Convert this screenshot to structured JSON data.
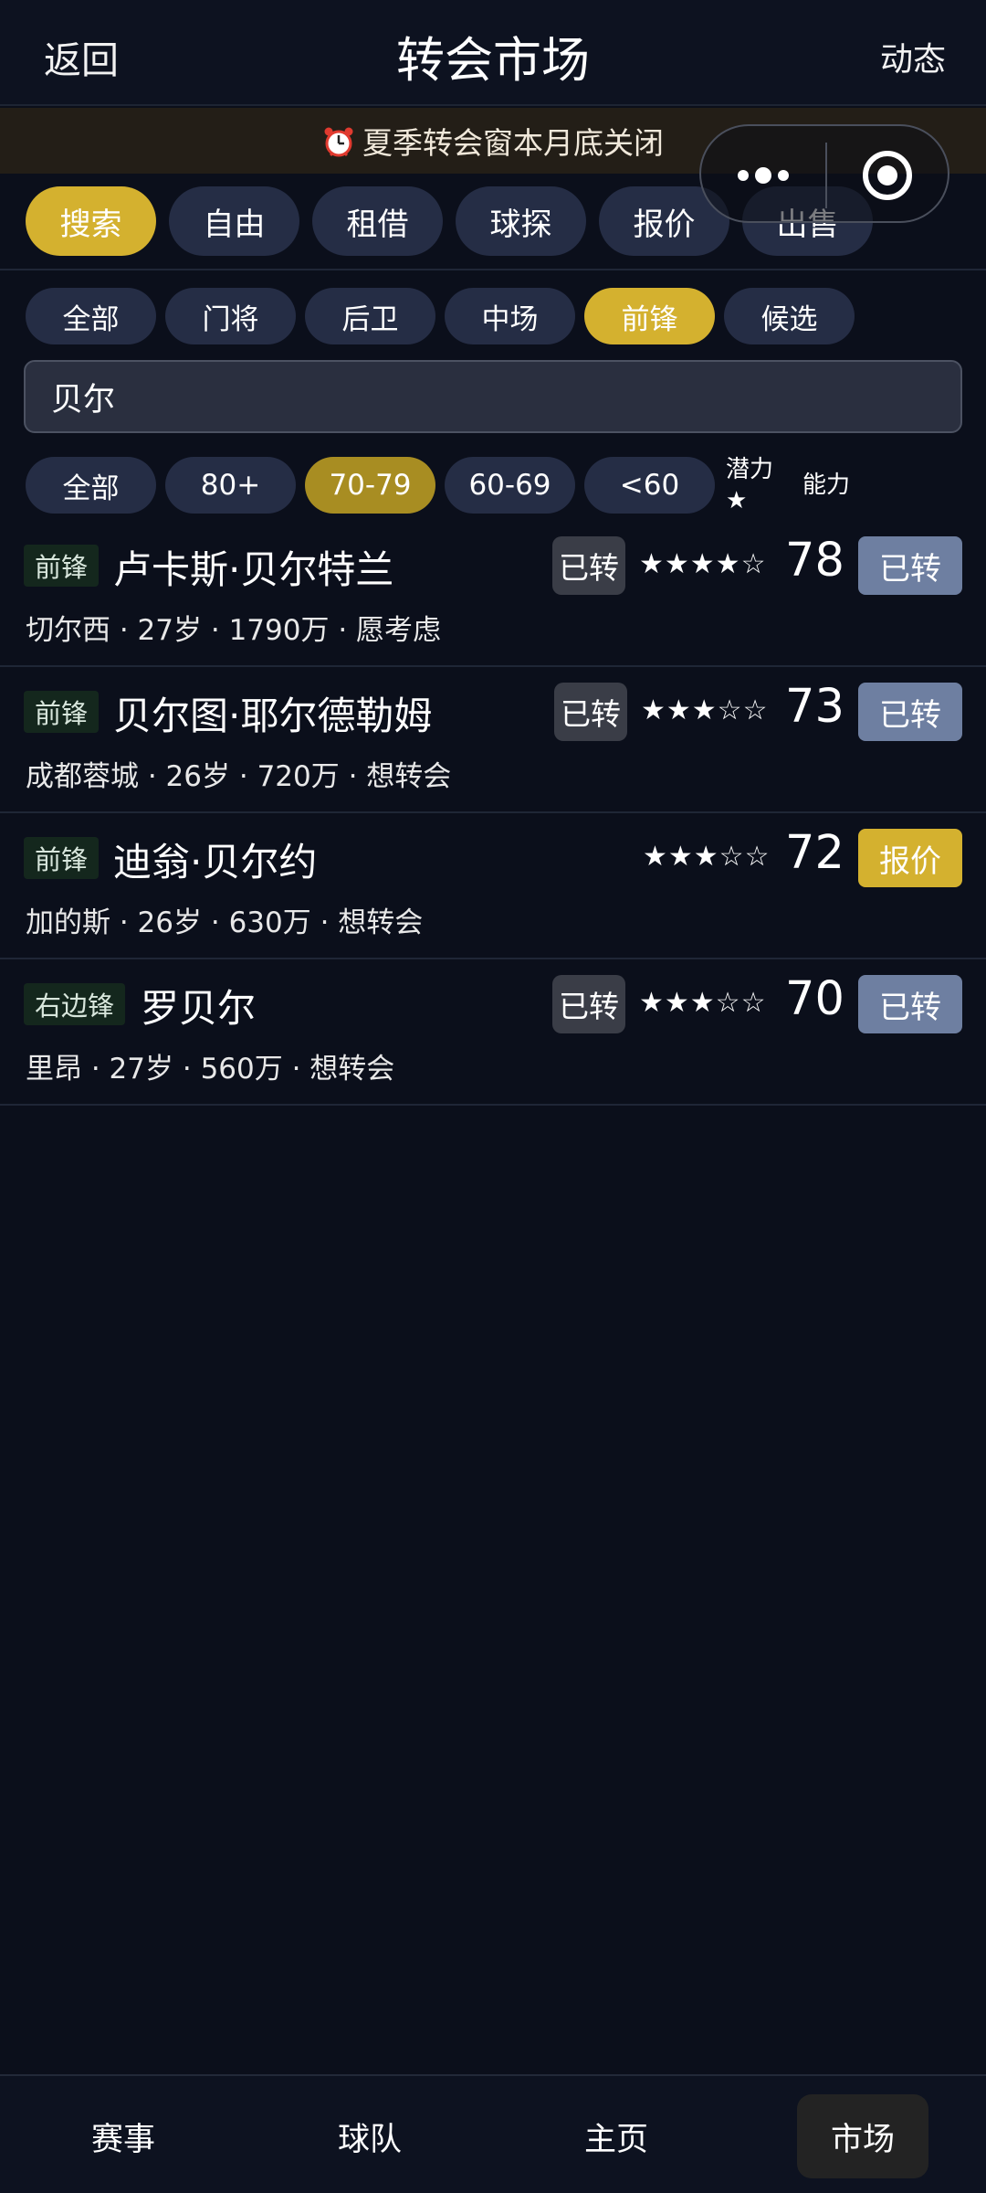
{
  "header": {
    "back_label": "返回",
    "title": "转会市场",
    "activity_label": "动态"
  },
  "banner": {
    "icon": "alarm-clock-icon",
    "text": "夏季转会窗本月底关闭"
  },
  "mini_program_capsule": {
    "more_icon": "more-dots-icon",
    "close_icon": "target-close-icon"
  },
  "tabs": [
    {
      "label": "搜索",
      "active": true
    },
    {
      "label": "自由",
      "active": false
    },
    {
      "label": "租借",
      "active": false
    },
    {
      "label": "球探",
      "active": false
    },
    {
      "label": "报价",
      "active": false
    },
    {
      "label": "出售",
      "active": false
    }
  ],
  "position_filters": [
    {
      "label": "全部",
      "active": false
    },
    {
      "label": "门将",
      "active": false
    },
    {
      "label": "后卫",
      "active": false
    },
    {
      "label": "中场",
      "active": false
    },
    {
      "label": "前锋",
      "active": true
    },
    {
      "label": "候选",
      "active": false
    }
  ],
  "search": {
    "value": "贝尔"
  },
  "rating_filters": [
    {
      "label": "全部",
      "active": false
    },
    {
      "label": "80+",
      "active": false
    },
    {
      "label": "70-79",
      "active": true
    },
    {
      "label": "60-69",
      "active": false
    },
    {
      "label": "<60",
      "active": false
    }
  ],
  "sort": {
    "potential_label": "潜力★",
    "ability_label": "能力"
  },
  "players": [
    {
      "position": "前锋",
      "name": "卢卡斯·贝尔特兰",
      "meta": "切尔西 · 27岁 · 1790万 · 愿考虑",
      "transferred_tag": "已转",
      "stars": "★★★★☆",
      "rating": "78",
      "action": "已转",
      "action_type": "done"
    },
    {
      "position": "前锋",
      "name": "贝尔图·耶尔德勒姆",
      "meta": "成都蓉城 · 26岁 · 720万 · 想转会",
      "transferred_tag": "已转",
      "stars": "★★★☆☆",
      "rating": "73",
      "action": "已转",
      "action_type": "done"
    },
    {
      "position": "前锋",
      "name": "迪翁·贝尔约",
      "meta": "加的斯 · 26岁 · 630万 · 想转会",
      "transferred_tag": "",
      "stars": "★★★☆☆",
      "rating": "72",
      "action": "报价",
      "action_type": "offer"
    },
    {
      "position": "右边锋",
      "name": "罗贝尔",
      "meta": "里昂 · 27岁 · 560万 · 想转会",
      "transferred_tag": "已转",
      "stars": "★★★☆☆",
      "rating": "70",
      "action": "已转",
      "action_type": "done"
    }
  ],
  "bottom_nav": [
    {
      "label": "赛事",
      "active": false
    },
    {
      "label": "球队",
      "active": false
    },
    {
      "label": "主页",
      "active": false
    },
    {
      "label": "市场",
      "active": true
    }
  ],
  "colors": {
    "background": "#0b0f1b",
    "accent": "#d4b12f",
    "chip": "#252d45",
    "done_button": "#6e7fa1"
  }
}
